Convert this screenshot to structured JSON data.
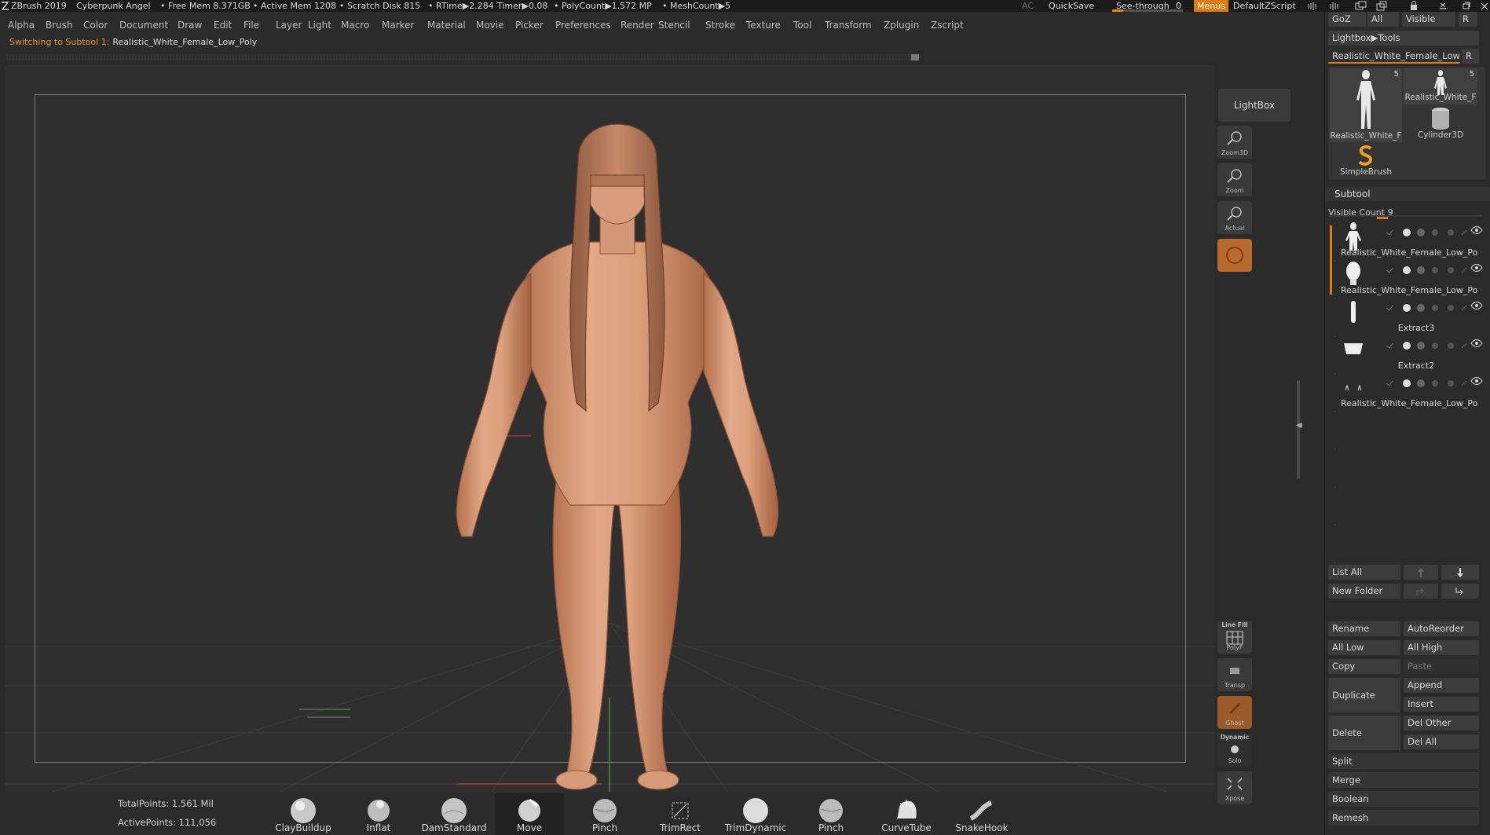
{
  "titlebar": {
    "app": "ZBrush 2019",
    "project": "Cyberpunk Angel",
    "freemem": "• Free Mem 8.371GB",
    "activemem": "• Active Mem 1208",
    "scratch": "• Scratch Disk 815",
    "rtime": "• RTime▶2.284",
    "timer": "Timer▶0.08",
    "polycount": "• PolyCount▶1.572 MP",
    "meshcount": "• MeshCount▶5",
    "ac": "AC",
    "quicksave": "QuickSave",
    "seethrough": "See-through",
    "seethrough_value": "0",
    "menus": "Menus",
    "script": "DefaultZScript"
  },
  "menubar": [
    "Alpha",
    "Brush",
    "Color",
    "Document",
    "Draw",
    "Edit",
    "File",
    "Layer",
    "Light",
    "Macro",
    "Marker",
    "Material",
    "Movie",
    "Picker",
    "Preferences",
    "Render",
    "Stencil",
    "Stroke",
    "Texture",
    "Tool",
    "Transform",
    "Zplugin",
    "Zscript"
  ],
  "notice": {
    "lead": "Switching to Subtool 1:",
    "name": "Realistic_White_Female_Low_Poly"
  },
  "shelf": {
    "lightbox": "LightBox",
    "zoom3d": "Zoom3D",
    "zoom": "Zoom",
    "actual": "Actual",
    "linefill_top": "Line Fill",
    "linefill": "PolyF",
    "transp": "Transp",
    "ghost": "Ghost",
    "dynamic": "Dynamic",
    "solo": "Solo",
    "xpose": "Xpose"
  },
  "tray": {
    "goz": "GoZ",
    "all": "All",
    "visible": "Visible",
    "r": "R",
    "lightbox_tools": "Lightbox▶Tools",
    "current_tool": "Realistic_White_Female_Low",
    "r2": "R",
    "thumbs": [
      {
        "label": "Realistic_White_F",
        "count": "5"
      },
      {
        "label": "Realistic_White_F",
        "count": "5"
      },
      {
        "label": "Cylinder3D",
        "count": ""
      },
      {
        "label": "SimpleBrush",
        "count": ""
      }
    ],
    "subtool_header": "Subtool",
    "visible_count": "Visible Count 9",
    "subtools": [
      "Realistic_White_Female_Low_Po",
      "Realistic_White_Female_Low_Po",
      "Extract3",
      "Extract2",
      "Realistic_White_Female_Low_Po"
    ],
    "list_all": "List All",
    "new_folder": "New Folder",
    "rename": "Rename",
    "autoreorder": "AutoReorder",
    "all_low": "All Low",
    "all_high": "All High",
    "copy": "Copy",
    "paste": "Paste",
    "duplicate": "Duplicate",
    "append": "Append",
    "insert": "Insert",
    "delete": "Delete",
    "del_other": "Del Other",
    "del_all": "Del All",
    "split": "Split",
    "merge": "Merge",
    "boolean": "Boolean",
    "remesh": "Remesh"
  },
  "stats": {
    "total": "TotalPoints: 1.561 Mil",
    "active": "ActivePoints: 111,056"
  },
  "brushes": [
    {
      "label": "ClayBuildup",
      "selected": false
    },
    {
      "label": "Inflat",
      "selected": false
    },
    {
      "label": "DamStandard",
      "selected": false
    },
    {
      "label": "Move",
      "selected": true
    },
    {
      "label": "Pinch",
      "selected": false
    },
    {
      "label": "TrimRect",
      "selected": false
    },
    {
      "label": "TrimDynamic",
      "selected": false
    },
    {
      "label": "Pinch",
      "selected": false
    },
    {
      "label": "CurveTube",
      "selected": false
    },
    {
      "label": "SnakeHook",
      "selected": false
    }
  ],
  "colors": {
    "accent": "#e07b14",
    "skin": "#d79b79",
    "skin_shadow": "#9c5f41",
    "background": "#2b2b2b"
  }
}
